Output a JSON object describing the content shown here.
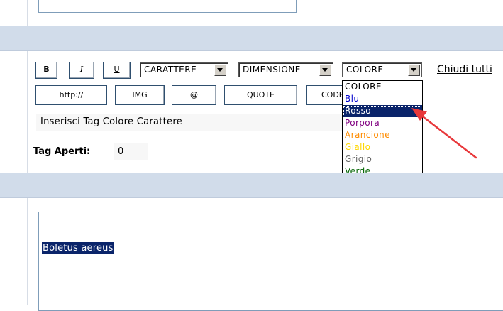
{
  "toolbar": {
    "bold_label": "B",
    "italic_label": "I",
    "underline_label": "U",
    "font_select": "CARATTERE",
    "size_select": "DIMENSIONE",
    "color_select": "COLORE",
    "close_all_link": "Chiudi tutti",
    "http_label": "http://",
    "img_label": "IMG",
    "email_label": "@",
    "quote_label": "QUOTE",
    "code_label": "CODE"
  },
  "helpline": "Inserisci Tag Colore Carattere",
  "open_tags": {
    "label": "Tag Aperti:",
    "value": "0"
  },
  "color_dropdown": {
    "options": [
      {
        "label": "COLORE",
        "color": "#000000"
      },
      {
        "label": "Blu",
        "color": "#0000cc"
      },
      {
        "label": "Rosso",
        "color": "#ffffff"
      },
      {
        "label": "Porpora",
        "color": "#800080"
      },
      {
        "label": "Arancione",
        "color": "#ff8c00"
      },
      {
        "label": "Giallo",
        "color": "#ffd700"
      },
      {
        "label": "Grigio",
        "color": "#666666"
      },
      {
        "label": "Verde",
        "color": "#006400"
      }
    ],
    "highlighted": "Rosso"
  },
  "editor": {
    "selected_text": "Boletus aereus"
  },
  "colors": {
    "band": "#d1dcea",
    "highlight": "#0a246a",
    "arrow": "#e8383b"
  }
}
